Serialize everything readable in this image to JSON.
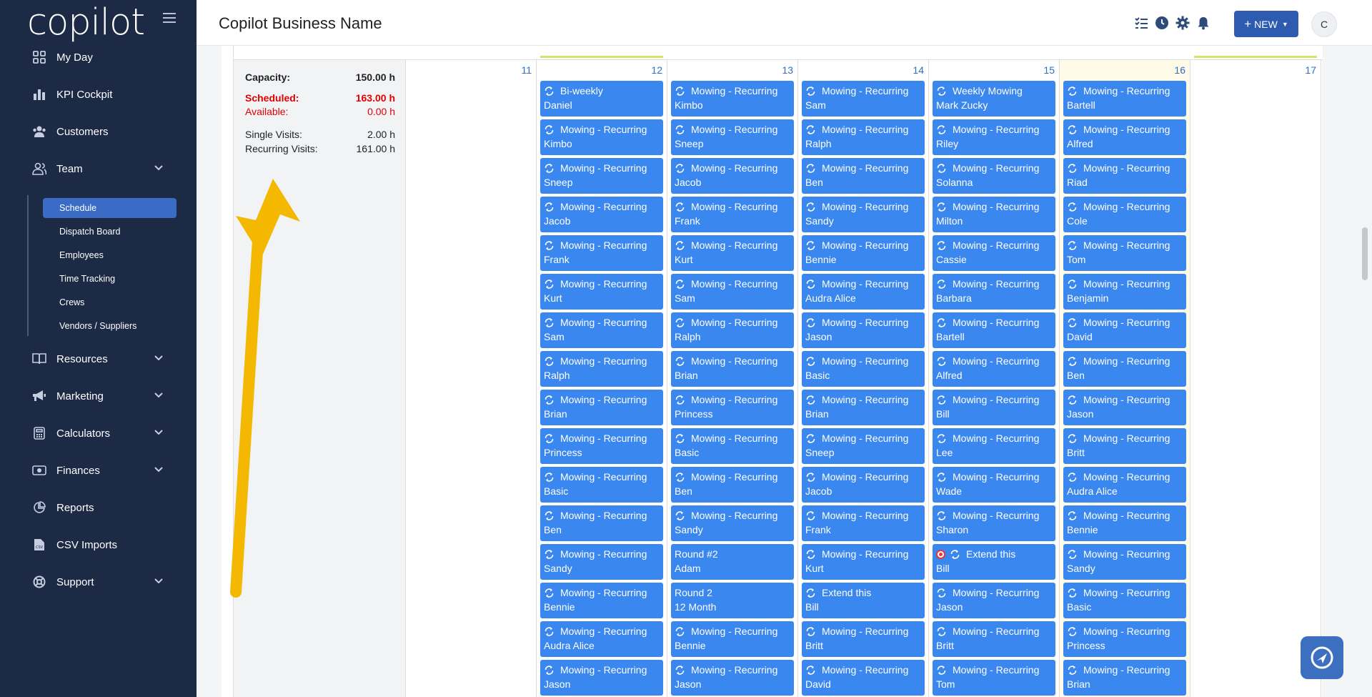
{
  "app": {
    "logo": "copilot",
    "business_name": "Copilot Business Name"
  },
  "sidebar": {
    "items": [
      {
        "label": "My Day",
        "icon": "dashboard-grid-icon"
      },
      {
        "label": "KPI Cockpit",
        "icon": "bar-chart-icon"
      },
      {
        "label": "Customers",
        "icon": "users-icon"
      },
      {
        "label": "Team",
        "icon": "team-icon",
        "expanded": true
      },
      {
        "label": "Resources",
        "icon": "book-icon"
      },
      {
        "label": "Marketing",
        "icon": "megaphone-icon"
      },
      {
        "label": "Calculators",
        "icon": "calculator-icon"
      },
      {
        "label": "Finances",
        "icon": "money-icon"
      },
      {
        "label": "Reports",
        "icon": "pie-chart-icon"
      },
      {
        "label": "CSV Imports",
        "icon": "csv-file-icon"
      },
      {
        "label": "Support",
        "icon": "lifebuoy-icon"
      }
    ],
    "team_sub": [
      "Schedule",
      "Dispatch Board",
      "Employees",
      "Time Tracking",
      "Crews",
      "Vendors / Suppliers"
    ],
    "active_sub": "Schedule"
  },
  "header": {
    "new_label": "NEW",
    "avatar_initial": "C"
  },
  "stats": {
    "capacity_label": "Capacity:",
    "capacity_value": "150.00 h",
    "scheduled_label": "Scheduled:",
    "scheduled_value": "163.00 h",
    "available_label": "Available:",
    "available_value": "0.00 h",
    "single_label": "Single Visits:",
    "single_value": "2.00 h",
    "recurring_label": "Recurring Visits:",
    "recurring_value": "161.00 h"
  },
  "days": [
    {
      "num": "11",
      "events": []
    },
    {
      "num": "12",
      "events": [
        {
          "t": "Bi-weekly",
          "n": "Daniel",
          "r": true
        },
        {
          "t": "Mowing - Recurring",
          "n": "Kimbo",
          "r": true
        },
        {
          "t": "Mowing - Recurring",
          "n": "Sneep",
          "r": true
        },
        {
          "t": "Mowing - Recurring",
          "n": "Jacob",
          "r": true
        },
        {
          "t": "Mowing - Recurring",
          "n": "Frank",
          "r": true
        },
        {
          "t": "Mowing - Recurring",
          "n": "Kurt",
          "r": true
        },
        {
          "t": "Mowing - Recurring",
          "n": "Sam",
          "r": true
        },
        {
          "t": "Mowing - Recurring",
          "n": "Ralph",
          "r": true
        },
        {
          "t": "Mowing - Recurring",
          "n": "Brian",
          "r": true
        },
        {
          "t": "Mowing - Recurring",
          "n": "Princess",
          "r": true
        },
        {
          "t": "Mowing - Recurring",
          "n": "Basic",
          "r": true
        },
        {
          "t": "Mowing - Recurring",
          "n": "Ben",
          "r": true
        },
        {
          "t": "Mowing - Recurring",
          "n": "Sandy",
          "r": true
        },
        {
          "t": "Mowing - Recurring",
          "n": "Bennie",
          "r": true
        },
        {
          "t": "Mowing - Recurring",
          "n": "Audra Alice",
          "r": true
        },
        {
          "t": "Mowing - Recurring",
          "n": "Jason",
          "r": true
        }
      ]
    },
    {
      "num": "13",
      "events": [
        {
          "t": "Mowing - Recurring",
          "n": "Kimbo",
          "r": true
        },
        {
          "t": "Mowing - Recurring",
          "n": "Sneep",
          "r": true
        },
        {
          "t": "Mowing - Recurring",
          "n": "Jacob",
          "r": true
        },
        {
          "t": "Mowing - Recurring",
          "n": "Frank",
          "r": true
        },
        {
          "t": "Mowing - Recurring",
          "n": "Kurt",
          "r": true
        },
        {
          "t": "Mowing - Recurring",
          "n": "Sam",
          "r": true
        },
        {
          "t": "Mowing - Recurring",
          "n": "Ralph",
          "r": true
        },
        {
          "t": "Mowing - Recurring",
          "n": "Brian",
          "r": true
        },
        {
          "t": "Mowing - Recurring",
          "n": "Princess",
          "r": true
        },
        {
          "t": "Mowing - Recurring",
          "n": "Basic",
          "r": true
        },
        {
          "t": "Mowing - Recurring",
          "n": "Ben",
          "r": true
        },
        {
          "t": "Mowing - Recurring",
          "n": "Sandy",
          "r": true
        },
        {
          "t": "Round #2",
          "n": "Adam",
          "r": false
        },
        {
          "t": "Round 2",
          "n": "12 Month",
          "r": false
        },
        {
          "t": "Mowing - Recurring",
          "n": "Bennie",
          "r": true
        },
        {
          "t": "Mowing - Recurring",
          "n": "Jason",
          "r": true
        }
      ]
    },
    {
      "num": "14",
      "events": [
        {
          "t": "Mowing - Recurring",
          "n": "Sam",
          "r": true
        },
        {
          "t": "Mowing - Recurring",
          "n": "Ralph",
          "r": true
        },
        {
          "t": "Mowing - Recurring",
          "n": "Ben",
          "r": true
        },
        {
          "t": "Mowing - Recurring",
          "n": "Sandy",
          "r": true
        },
        {
          "t": "Mowing - Recurring",
          "n": "Bennie",
          "r": true
        },
        {
          "t": "Mowing - Recurring",
          "n": "Audra Alice",
          "r": true
        },
        {
          "t": "Mowing - Recurring",
          "n": "Jason",
          "r": true
        },
        {
          "t": "Mowing - Recurring",
          "n": "Basic",
          "r": true
        },
        {
          "t": "Mowing - Recurring",
          "n": "Brian",
          "r": true
        },
        {
          "t": "Mowing - Recurring",
          "n": "Sneep",
          "r": true
        },
        {
          "t": "Mowing - Recurring",
          "n": "Jacob",
          "r": true
        },
        {
          "t": "Mowing - Recurring",
          "n": "Frank",
          "r": true
        },
        {
          "t": "Mowing - Recurring",
          "n": "Kurt",
          "r": true
        },
        {
          "t": "Extend this",
          "n": "Bill",
          "r": true
        },
        {
          "t": "Mowing - Recurring",
          "n": "Britt",
          "r": true
        },
        {
          "t": "Mowing - Recurring",
          "n": "David",
          "r": true
        }
      ]
    },
    {
      "num": "15",
      "events": [
        {
          "t": "Weekly Mowing",
          "n": "Mark Zucky",
          "r": true
        },
        {
          "t": "Mowing - Recurring",
          "n": "Riley",
          "r": true
        },
        {
          "t": "Mowing - Recurring",
          "n": "Solanna",
          "r": true
        },
        {
          "t": "Mowing - Recurring",
          "n": "Milton",
          "r": true
        },
        {
          "t": "Mowing - Recurring",
          "n": "Cassie",
          "r": true
        },
        {
          "t": "Mowing - Recurring",
          "n": "Barbara",
          "r": true
        },
        {
          "t": "Mowing - Recurring",
          "n": "Bartell",
          "r": true
        },
        {
          "t": "Mowing - Recurring",
          "n": "Alfred",
          "r": true
        },
        {
          "t": "Mowing - Recurring",
          "n": "Bill",
          "r": true
        },
        {
          "t": "Mowing - Recurring",
          "n": "Lee",
          "r": true
        },
        {
          "t": "Mowing - Recurring",
          "n": "Wade",
          "r": true
        },
        {
          "t": "Mowing - Recurring",
          "n": "Sharon",
          "r": true
        },
        {
          "t": "Extend this",
          "n": "Bill",
          "r": true,
          "dot": true
        },
        {
          "t": "Mowing - Recurring",
          "n": "Jason",
          "r": true
        },
        {
          "t": "Mowing - Recurring",
          "n": "Britt",
          "r": true
        },
        {
          "t": "Mowing - Recurring",
          "n": "Tom",
          "r": true
        }
      ]
    },
    {
      "num": "16",
      "today": true,
      "events": [
        {
          "t": "Mowing - Recurring",
          "n": "Bartell",
          "r": true
        },
        {
          "t": "Mowing - Recurring",
          "n": "Alfred",
          "r": true
        },
        {
          "t": "Mowing - Recurring",
          "n": "Riad",
          "r": true
        },
        {
          "t": "Mowing - Recurring",
          "n": "Cole",
          "r": true
        },
        {
          "t": "Mowing - Recurring",
          "n": "Tom",
          "r": true
        },
        {
          "t": "Mowing - Recurring",
          "n": "Benjamin",
          "r": true
        },
        {
          "t": "Mowing - Recurring",
          "n": "David",
          "r": true
        },
        {
          "t": "Mowing - Recurring",
          "n": "Ben",
          "r": true
        },
        {
          "t": "Mowing - Recurring",
          "n": "Jason",
          "r": true
        },
        {
          "t": "Mowing - Recurring",
          "n": "Britt",
          "r": true
        },
        {
          "t": "Mowing - Recurring",
          "n": "Audra Alice",
          "r": true
        },
        {
          "t": "Mowing - Recurring",
          "n": "Bennie",
          "r": true
        },
        {
          "t": "Mowing - Recurring",
          "n": "Sandy",
          "r": true
        },
        {
          "t": "Mowing - Recurring",
          "n": "Basic",
          "r": true
        },
        {
          "t": "Mowing - Recurring",
          "n": "Princess",
          "r": true
        },
        {
          "t": "Mowing - Recurring",
          "n": "Brian",
          "r": true
        }
      ]
    },
    {
      "num": "17",
      "events": []
    }
  ],
  "colors": {
    "sidebar_bg": "#1c2a45",
    "event_blue": "#3a87f0",
    "accent": "#2d5bb0",
    "scheduled_red": "#e00000",
    "arrow": "#f5b800"
  }
}
